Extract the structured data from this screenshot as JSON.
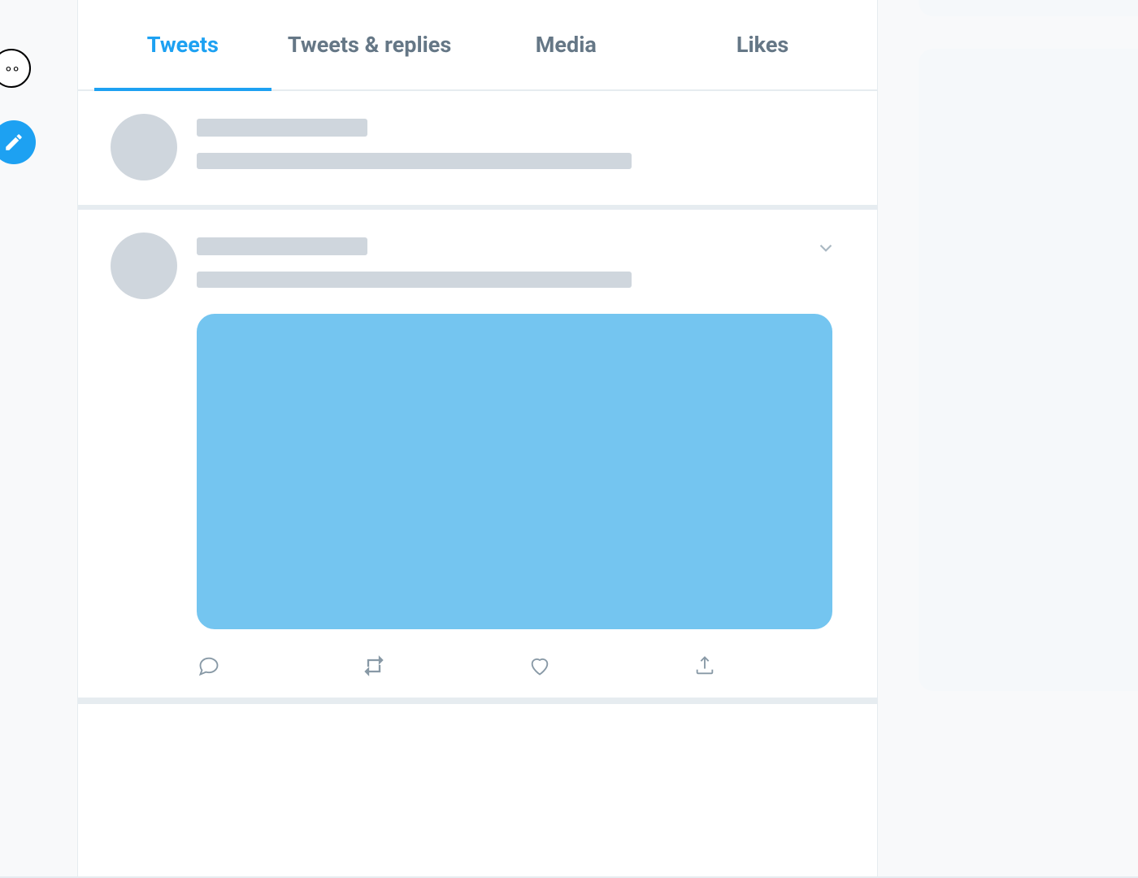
{
  "nav": {
    "more_icon": "more-icon",
    "compose_icon": "compose-icon"
  },
  "tabs": [
    {
      "label": "Tweets",
      "active": true
    },
    {
      "label": "Tweets & replies",
      "active": false
    },
    {
      "label": "Media",
      "active": false
    },
    {
      "label": "Likes",
      "active": false
    }
  ],
  "timeline": [
    {
      "has_media": false,
      "has_caret": false,
      "has_actions": false
    },
    {
      "has_media": true,
      "has_caret": true,
      "has_actions": true
    }
  ],
  "actions": {
    "reply": "reply-icon",
    "retweet": "retweet-icon",
    "like": "like-icon",
    "share": "share-icon"
  }
}
